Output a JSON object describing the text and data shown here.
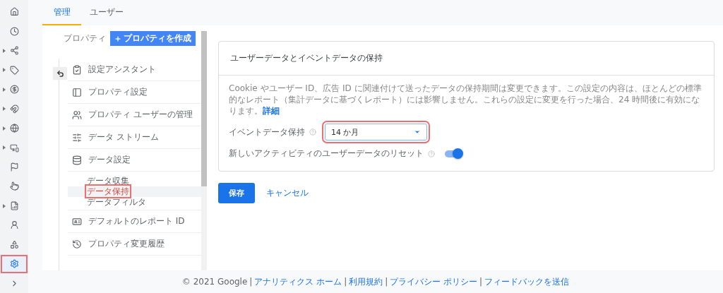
{
  "rail": [
    {
      "expandable": false,
      "selected": false,
      "highlighted": false
    },
    {
      "expandable": false,
      "selected": false,
      "highlighted": false
    },
    {
      "expandable": true,
      "selected": false,
      "highlighted": false
    },
    {
      "expandable": true,
      "selected": false,
      "highlighted": false
    },
    {
      "expandable": true,
      "selected": false,
      "highlighted": false
    },
    {
      "expandable": true,
      "selected": false,
      "highlighted": false
    },
    {
      "expandable": true,
      "selected": false,
      "highlighted": false
    },
    {
      "expandable": true,
      "selected": false,
      "highlighted": false
    },
    {
      "expandable": false,
      "selected": false,
      "highlighted": false
    },
    {
      "expandable": false,
      "selected": false,
      "highlighted": false
    },
    {
      "expandable": true,
      "selected": false,
      "highlighted": false
    },
    {
      "expandable": false,
      "selected": false,
      "highlighted": false
    },
    {
      "expandable": false,
      "selected": false,
      "highlighted": false
    },
    {
      "expandable": false,
      "selected": true,
      "highlighted": true
    },
    {
      "expandable": false,
      "selected": false,
      "highlighted": false
    }
  ],
  "tabs": [
    {
      "label": "管理",
      "selected": true
    },
    {
      "label": "ユーザー",
      "selected": false
    }
  ],
  "property": {
    "label": "プロパティ",
    "create_button": "プロパティを作成"
  },
  "nav": [
    {
      "label": "設定アシスタント"
    },
    {
      "label": "プロパティ設定"
    },
    {
      "label": "プロパティ ユーザーの管理"
    },
    {
      "label": "データ ストリーム"
    },
    {
      "label": "データ設定",
      "children": [
        {
          "label": "データ収集",
          "selected": false,
          "highlighted": false
        },
        {
          "label": "データ保持",
          "selected": true,
          "highlighted": true
        },
        {
          "label": "データフィルタ",
          "selected": false,
          "highlighted": false
        }
      ]
    },
    {
      "label": "デフォルトのレポート ID"
    },
    {
      "label": "プロパティ変更履歴"
    }
  ],
  "card": {
    "title": "ユーザーデータとイベントデータの保持",
    "description": "Cookie やユーザー ID、広告 ID に関連付けて送ったデータの保持期間は変更できます。この設定の内容は、ほとんどの標準的なレポート（集計データに基づくレポート）には影響しません。これらの設定に変更を行った場合、24 時間後に有効になります。",
    "link": "詳細",
    "retention": {
      "label": "イベントデータ保持",
      "value": "14 か月",
      "highlighted": true
    },
    "reset": {
      "label": "新しいアクティビティのユーザーデータのリセット",
      "on": true
    }
  },
  "buttons": {
    "save": "保存",
    "cancel": "キャンセル"
  },
  "footer": {
    "copyright": "© 2021 Google",
    "separator": "|",
    "links": [
      "アナリティクス ホーム",
      "利用規約",
      "プライバシー ポリシー",
      "フィードバックを送信"
    ]
  }
}
